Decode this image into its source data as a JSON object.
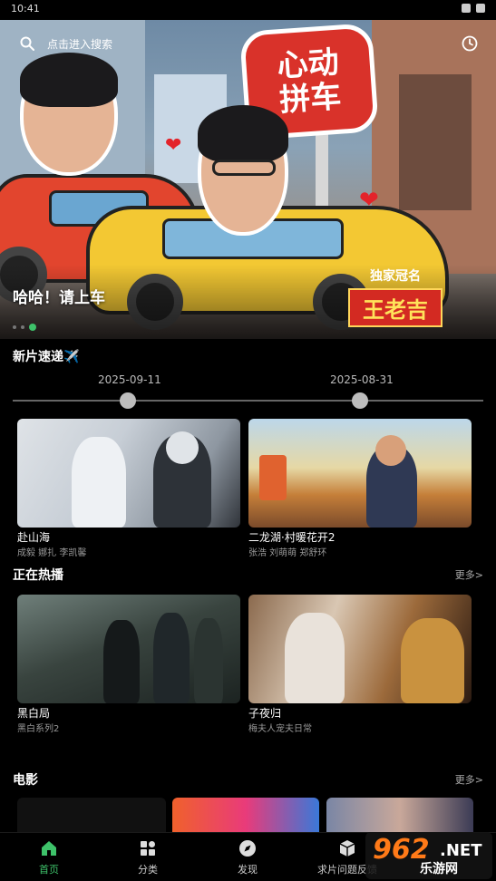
{
  "status_bar": {
    "time": "10:41"
  },
  "search": {
    "placeholder": "点击进入搜索"
  },
  "banner": {
    "caption": "哈哈！请上车",
    "sign_text": "心动拼车",
    "sponsor_label": "独家冠名",
    "sponsor_brand": "王老吉"
  },
  "new_releases": {
    "title": "新片速递✈️",
    "dates": [
      "2025-09-11",
      "2025-08-31"
    ],
    "items": [
      {
        "title": "赴山海",
        "cast": "成毅 娜扎 李凯馨"
      },
      {
        "title": "二龙湖·村暖花开2",
        "cast": "张浩 刘萌萌 郑舒环"
      }
    ]
  },
  "trending": {
    "title": "正在热播",
    "more": "更多>",
    "items": [
      {
        "title": "黑白局",
        "sub": "黑白系列2"
      },
      {
        "title": "子夜归",
        "sub": "梅夫人宠夫日常"
      }
    ]
  },
  "movies": {
    "title": "电影",
    "more": "更多>"
  },
  "bottom_nav": [
    {
      "label": "首页",
      "icon": "home-icon",
      "active": true
    },
    {
      "label": "分类",
      "icon": "category-icon",
      "active": false
    },
    {
      "label": "发现",
      "icon": "compass-icon",
      "active": false
    },
    {
      "label": "求片问题反馈",
      "icon": "box-icon",
      "active": false
    }
  ],
  "watermark": {
    "number": "962",
    "suffix": ".NET",
    "text": "乐游网"
  },
  "colors": {
    "accent": "#3ec26a",
    "background": "#000000"
  }
}
